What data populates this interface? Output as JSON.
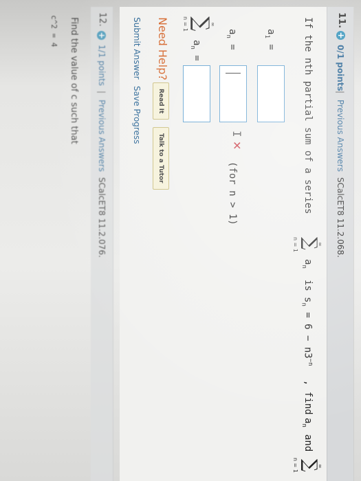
{
  "q11": {
    "number": "11.",
    "points": "0/1 points",
    "separator": "|",
    "previous_answers": "Previous Answers",
    "code": "SCalcET8 11.2.068.",
    "prompt_start": "If the nth partial sum of a series",
    "term_an": "a",
    "is_text": "is",
    "sn_expr": "s",
    "sn_value": "= 6 − n3",
    "exp": "−n",
    "find_text": ", find",
    "and_text": "and",
    "label_a1": "a",
    "label_a1_sub": "1",
    "eq": "=",
    "label_an": "a",
    "label_an_sub": "n",
    "condition": "(for n > 1)",
    "sigma_symbol": "∑",
    "sigma_top": "∞",
    "sigma_bottom": "n = 1",
    "sum_label": "a",
    "sum_label_sub": "n",
    "need_help": "Need Help?",
    "read_it": "Read It",
    "talk_to_tutor": "Talk to a Tutor",
    "submit_answer": "Submit Answer",
    "save_progress": "Save Progress"
  },
  "q12": {
    "number": "12.",
    "points": "1/1 points",
    "separator": "|",
    "previous_answers": "Previous Answers",
    "code": "SCalcET8 11.2.076.",
    "prompt": "Find the value of c such that",
    "partial": "c^2 = 4"
  },
  "colors": {
    "link": "#1f5e90",
    "help": "#d25c1e",
    "error": "#c8323c",
    "input_border": "#5a9ecf"
  },
  "icons": {
    "expand": "plus-circle-icon",
    "incorrect": "x-mark-icon",
    "text_cursor": "i-beam-cursor-icon"
  }
}
